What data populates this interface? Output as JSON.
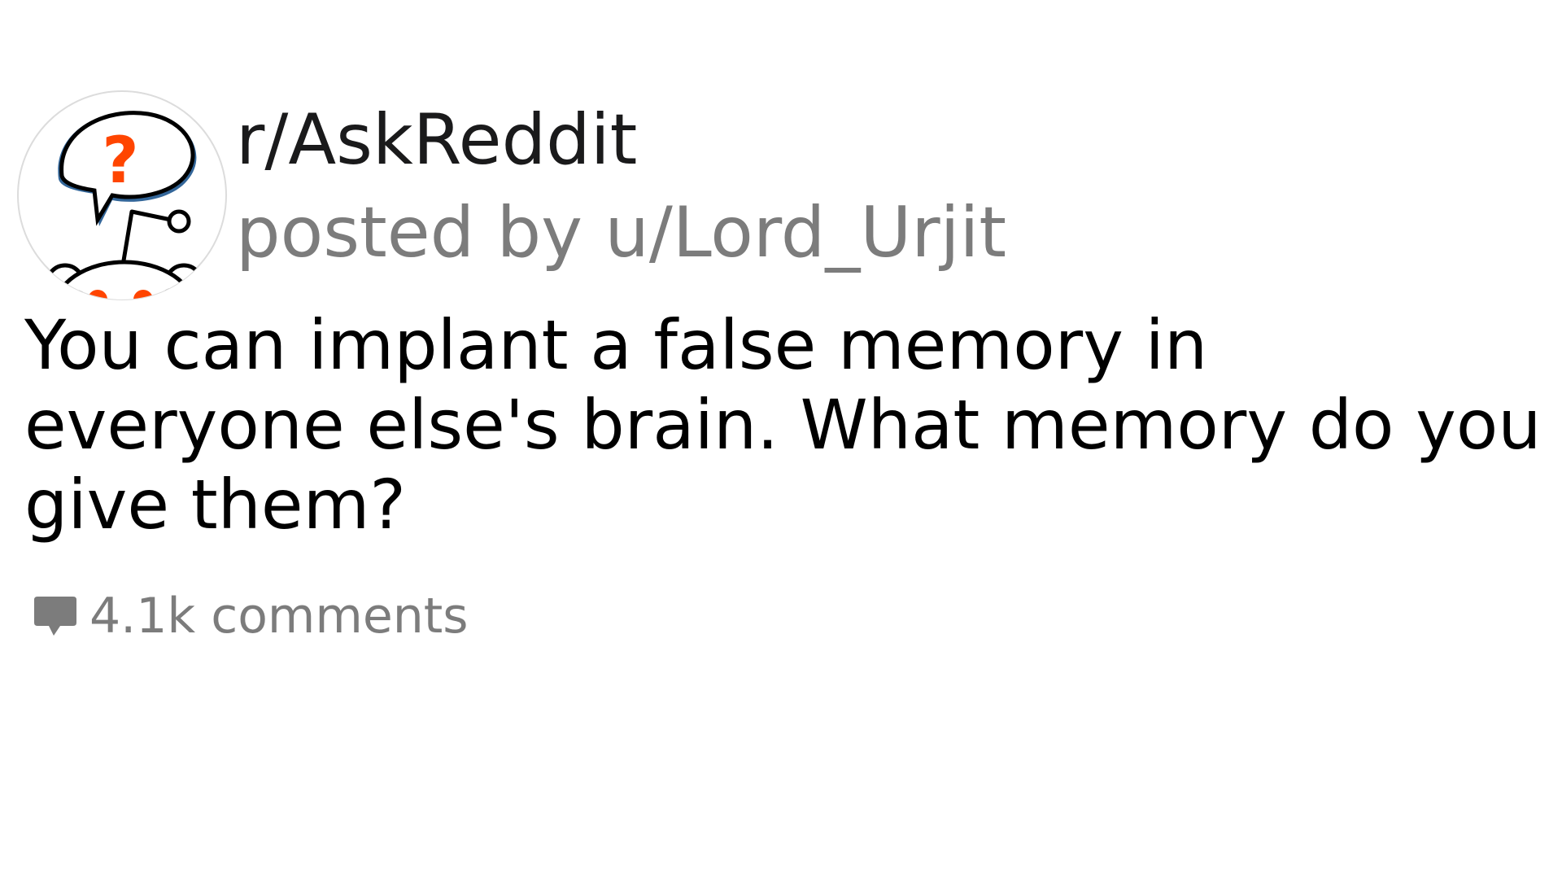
{
  "post": {
    "subreddit": "r/AskReddit",
    "posted_by": "posted by u/Lord_Urjit",
    "title": "You can implant a false memory in everyone else's brain. What memory do you give them?",
    "comments_label": "4.1k comments"
  },
  "icons": {
    "avatar": "askreddit-snoo-question-icon",
    "comments": "comment-bubble-icon"
  },
  "colors": {
    "accent": "#ff4500",
    "muted_text": "#7c7c7c",
    "primary_text": "#1a1a1b",
    "bubble_blue": "#336699"
  }
}
